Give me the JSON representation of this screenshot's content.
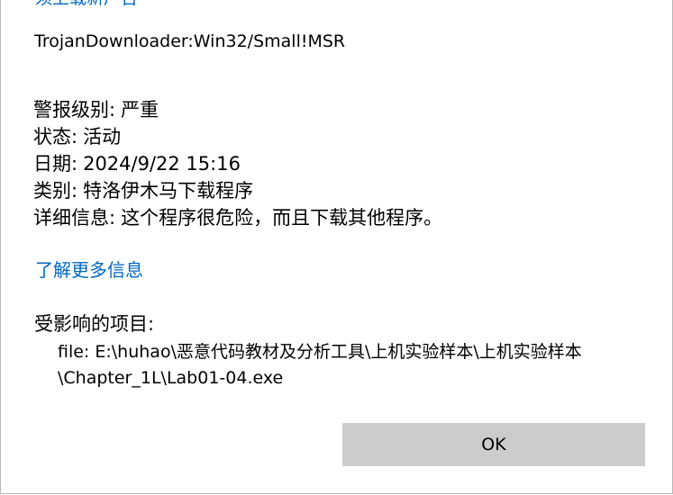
{
  "dialog": {
    "clipped_top_link": "须上载新广告",
    "threat_name": "TrojanDownloader:Win32/Small!MSR",
    "details": [
      {
        "label": "警报级别:",
        "value": "严重"
      },
      {
        "label": "状态:",
        "value": "活动"
      },
      {
        "label": "日期:",
        "value": "2024/9/22 15:16"
      },
      {
        "label": "类别:",
        "value": "特洛伊木马下载程序"
      },
      {
        "label": "详细信息:",
        "value": "这个程序很危险，而且下载其他程序。"
      }
    ],
    "learn_more_link": "了解更多信息",
    "affected_heading": "受影响的项目:",
    "affected_item_line1": "file: E:\\huhao\\恶意代码教材及分析工具\\上机实验样本\\上机实验样本",
    "affected_item_line2": "\\Chapter_1L\\Lab01-04.exe",
    "ok_label": "OK"
  },
  "colors": {
    "link": "#0067c0",
    "button_bg": "#cccccc",
    "background": "#ffffff",
    "text": "#000000"
  }
}
